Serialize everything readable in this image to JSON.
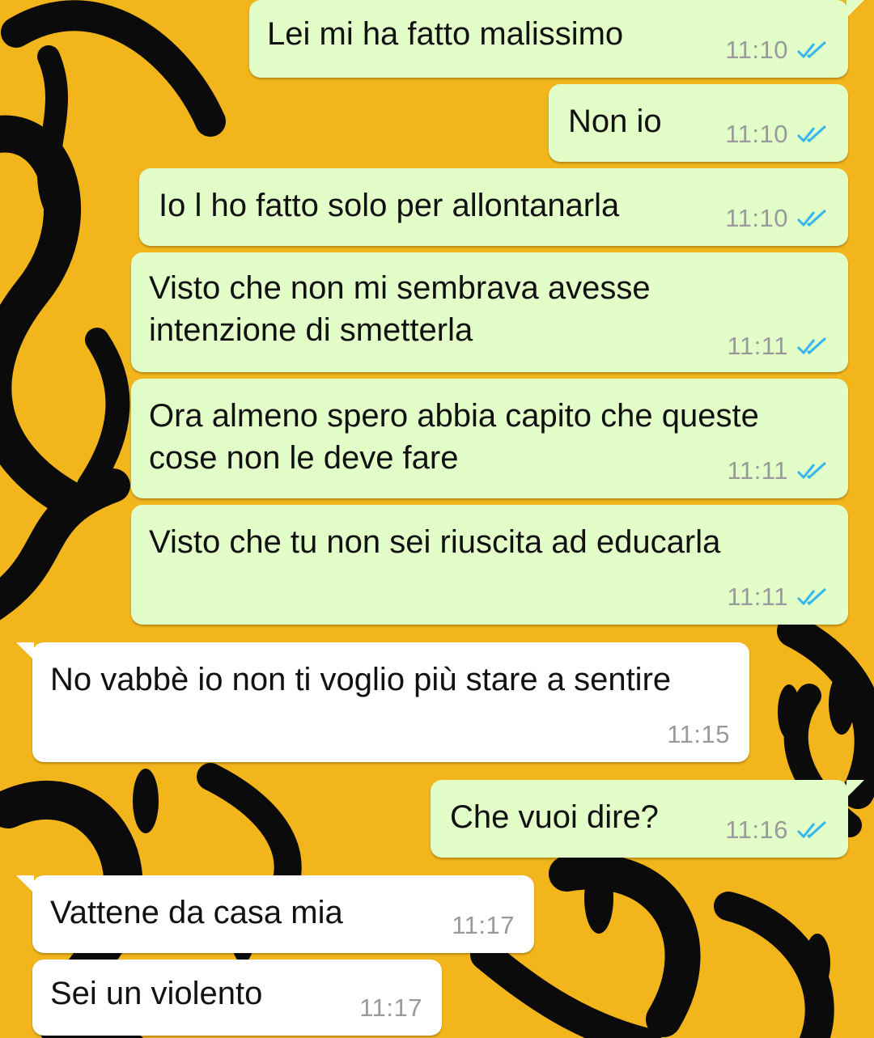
{
  "wallpaper": {
    "name": "smiley-faces-pattern",
    "colors": {
      "base": "#f2b51c",
      "ink": "#0b0b0b"
    }
  },
  "colors": {
    "outgoing_bubble": "#e2fdc8",
    "incoming_bubble": "#ffffff",
    "read_ticks": "#34b7f1",
    "timestamp": "#9a9a9a"
  },
  "messages": [
    {
      "direction": "outgoing",
      "text": "Lei mi ha fatto malissimo",
      "time": "11:10",
      "status": "read"
    },
    {
      "direction": "outgoing",
      "text": "Non io",
      "time": "11:10",
      "status": "read"
    },
    {
      "direction": "outgoing",
      "text": "Io l ho fatto solo per allontanarla",
      "time": "11:10",
      "status": "read"
    },
    {
      "direction": "outgoing",
      "text": "Visto che non mi sembrava avesse\nintenzione di smetterla",
      "time": "11:11",
      "status": "read"
    },
    {
      "direction": "outgoing",
      "text": "Ora almeno spero abbia capito che queste\ncose non le deve fare",
      "time": "11:11",
      "status": "read"
    },
    {
      "direction": "outgoing",
      "text": "Visto che tu non sei riuscita ad educarla",
      "time": "11:11",
      "status": "read"
    },
    {
      "direction": "incoming",
      "text": "No vabbè io non ti voglio più stare a sentire",
      "time": "11:15"
    },
    {
      "direction": "outgoing",
      "text": "Che vuoi dire?",
      "time": "11:16",
      "status": "read"
    },
    {
      "direction": "incoming",
      "text": "Vattene da casa mia",
      "time": "11:17"
    },
    {
      "direction": "incoming",
      "text": "Sei un violento",
      "time": "11:17"
    }
  ]
}
